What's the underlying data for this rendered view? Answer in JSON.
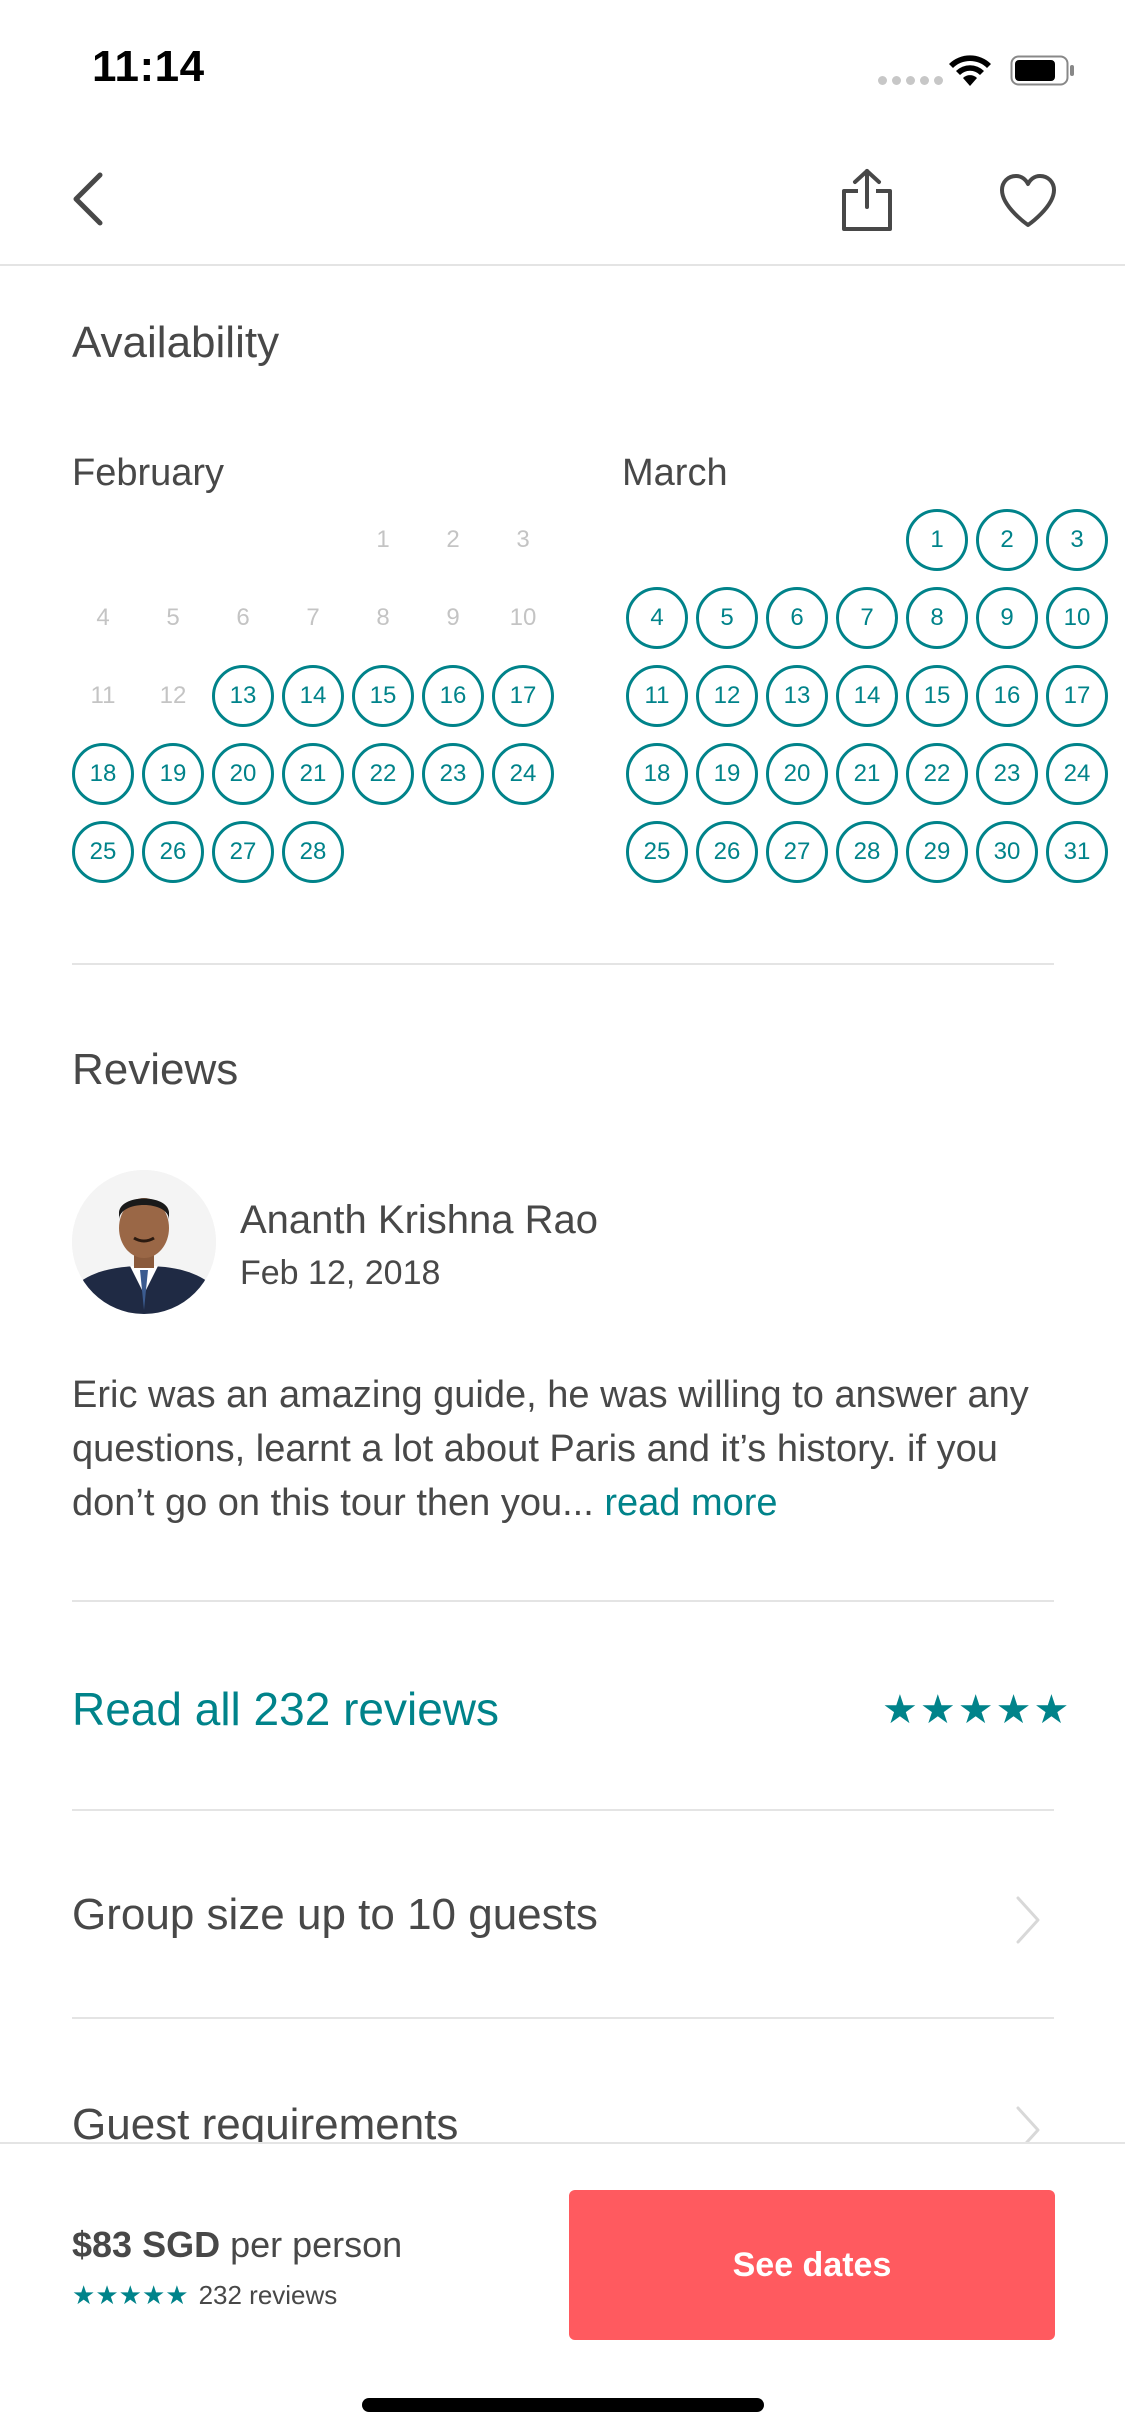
{
  "status_bar": {
    "time": "11:14"
  },
  "availability": {
    "title": "Availability",
    "months": [
      {
        "name": "February",
        "days": [
          {
            "d": "1",
            "s": "disabled"
          },
          {
            "d": "2",
            "s": "disabled"
          },
          {
            "d": "3",
            "s": "disabled"
          },
          {
            "d": "4",
            "s": "disabled"
          },
          {
            "d": "5",
            "s": "disabled"
          },
          {
            "d": "6",
            "s": "disabled"
          },
          {
            "d": "7",
            "s": "disabled"
          },
          {
            "d": "8",
            "s": "disabled"
          },
          {
            "d": "9",
            "s": "disabled"
          },
          {
            "d": "10",
            "s": "disabled"
          },
          {
            "d": "11",
            "s": "disabled"
          },
          {
            "d": "12",
            "s": "disabled"
          },
          {
            "d": "13",
            "s": "available"
          },
          {
            "d": "14",
            "s": "available"
          },
          {
            "d": "15",
            "s": "available"
          },
          {
            "d": "16",
            "s": "available"
          },
          {
            "d": "17",
            "s": "available"
          },
          {
            "d": "18",
            "s": "available"
          },
          {
            "d": "19",
            "s": "available"
          },
          {
            "d": "20",
            "s": "available"
          },
          {
            "d": "21",
            "s": "available"
          },
          {
            "d": "22",
            "s": "available"
          },
          {
            "d": "23",
            "s": "available"
          },
          {
            "d": "24",
            "s": "available"
          },
          {
            "d": "25",
            "s": "available"
          },
          {
            "d": "26",
            "s": "available"
          },
          {
            "d": "27",
            "s": "available"
          },
          {
            "d": "28",
            "s": "available"
          }
        ],
        "first_weekday": 4
      },
      {
        "name": "March",
        "days": [
          {
            "d": "1",
            "s": "available"
          },
          {
            "d": "2",
            "s": "available"
          },
          {
            "d": "3",
            "s": "available"
          },
          {
            "d": "4",
            "s": "available"
          },
          {
            "d": "5",
            "s": "available"
          },
          {
            "d": "6",
            "s": "available"
          },
          {
            "d": "7",
            "s": "available"
          },
          {
            "d": "8",
            "s": "available"
          },
          {
            "d": "9",
            "s": "available"
          },
          {
            "d": "10",
            "s": "available"
          },
          {
            "d": "11",
            "s": "available"
          },
          {
            "d": "12",
            "s": "available"
          },
          {
            "d": "13",
            "s": "available"
          },
          {
            "d": "14",
            "s": "available"
          },
          {
            "d": "15",
            "s": "available"
          },
          {
            "d": "16",
            "s": "available"
          },
          {
            "d": "17",
            "s": "available"
          },
          {
            "d": "18",
            "s": "available"
          },
          {
            "d": "19",
            "s": "available"
          },
          {
            "d": "20",
            "s": "available"
          },
          {
            "d": "21",
            "s": "available"
          },
          {
            "d": "22",
            "s": "available"
          },
          {
            "d": "23",
            "s": "available"
          },
          {
            "d": "24",
            "s": "available"
          },
          {
            "d": "25",
            "s": "available"
          },
          {
            "d": "26",
            "s": "available"
          },
          {
            "d": "27",
            "s": "available"
          },
          {
            "d": "28",
            "s": "available"
          },
          {
            "d": "29",
            "s": "available"
          },
          {
            "d": "30",
            "s": "available"
          },
          {
            "d": "31",
            "s": "available"
          }
        ],
        "first_weekday": 4
      }
    ]
  },
  "reviews": {
    "title": "Reviews",
    "reviewer_name": "Ananth Krishna Rao",
    "date": "Feb 12, 2018",
    "text": "Eric was an amazing guide, he was willing to answer any questions, learnt a lot about Paris and it’s history. if you don’t go on this tour then you...",
    "read_more": "read more",
    "read_all": "Read all 232 reviews",
    "rating": 5
  },
  "rows": {
    "group_size": "Group size up to 10 guests",
    "guest_requirements": "Guest requirements"
  },
  "footer": {
    "price": "$83 SGD",
    "per": "per person",
    "review_count": "232 reviews",
    "button": "See dates"
  },
  "colors": {
    "accent": "#00838a",
    "cta": "#ff5a5f",
    "text": "#484848",
    "disabled": "#c4c4c4"
  }
}
